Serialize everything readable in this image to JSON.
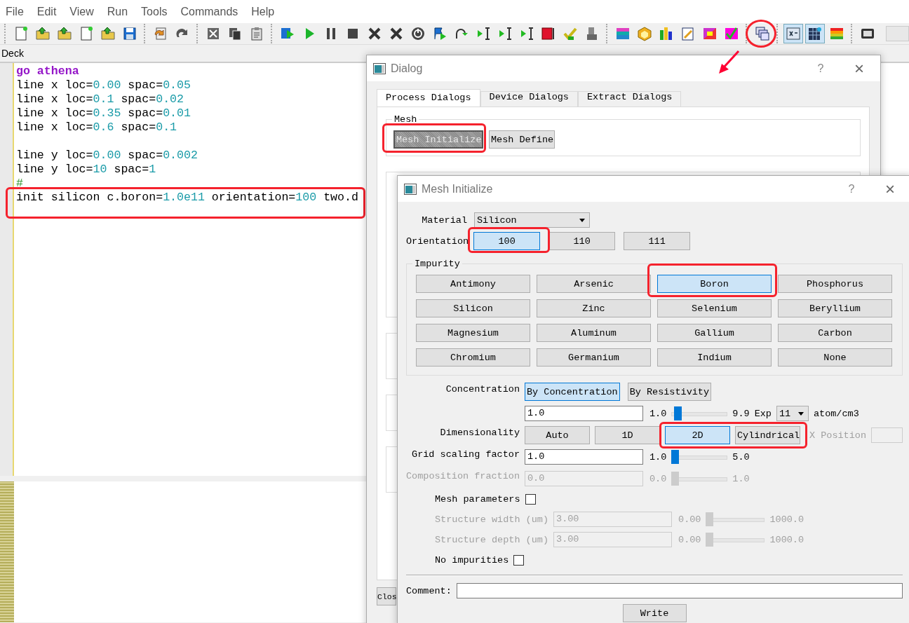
{
  "menu": [
    "File",
    "Edit",
    "View",
    "Run",
    "Tools",
    "Commands",
    "Help"
  ],
  "toolbar": [
    {
      "buttons": [
        {
          "kind": "page"
        },
        {
          "kind": "folder"
        },
        {
          "kind": "folder"
        },
        {
          "kind": "page"
        },
        {
          "kind": "folder"
        },
        {
          "kind": "floppy"
        }
      ]
    },
    {
      "buttons": [
        {
          "kind": "undo"
        },
        {
          "kind": "redo"
        }
      ]
    },
    {
      "buttons": [
        {
          "kind": "scissors"
        },
        {
          "kind": "copy"
        },
        {
          "kind": "clipboard"
        }
      ]
    },
    {
      "buttons": [
        {
          "kind": "floppy-play"
        },
        {
          "kind": "play"
        },
        {
          "kind": "pause"
        },
        {
          "kind": "stop"
        },
        {
          "kind": "cross"
        },
        {
          "kind": "cross"
        },
        {
          "kind": "power"
        },
        {
          "kind": "flag"
        },
        {
          "kind": "curve"
        },
        {
          "kind": "step"
        },
        {
          "kind": "step"
        },
        {
          "kind": "step"
        },
        {
          "kind": "red-square"
        },
        {
          "kind": "check"
        },
        {
          "kind": "device"
        }
      ]
    },
    {
      "buttons": [
        {
          "kind": "layers"
        },
        {
          "kind": "cube"
        },
        {
          "kind": "chart"
        },
        {
          "kind": "pencil"
        },
        {
          "kind": "palette"
        },
        {
          "kind": "check-grid"
        }
      ]
    },
    {
      "buttons": [
        {
          "kind": "windows",
          "highlighted": true,
          "arrow": true
        }
      ]
    },
    {
      "buttons": [
        {
          "kind": "formula",
          "on": true
        },
        {
          "kind": "table",
          "on": true
        },
        {
          "kind": "bars",
          "on": false
        }
      ]
    },
    {
      "buttons": [
        {
          "kind": "monitor"
        }
      ]
    }
  ],
  "deck": {
    "label": "Deck",
    "lines": [
      {
        "kind": "code",
        "tokens": [
          {
            "kind": "keyword",
            "text": "go athena"
          }
        ]
      },
      {
        "kind": "code",
        "tokens": [
          {
            "kind": "text",
            "text": "line x loc="
          },
          {
            "kind": "number",
            "text": "0.00"
          },
          {
            "kind": "text",
            "text": " spac="
          },
          {
            "kind": "number",
            "text": "0.05"
          }
        ]
      },
      {
        "kind": "code",
        "tokens": [
          {
            "kind": "text",
            "text": "line x loc="
          },
          {
            "kind": "number",
            "text": "0.1"
          },
          {
            "kind": "text",
            "text": " spac="
          },
          {
            "kind": "number",
            "text": "0.02"
          }
        ]
      },
      {
        "kind": "code",
        "tokens": [
          {
            "kind": "text",
            "text": "line x loc="
          },
          {
            "kind": "number",
            "text": "0.35"
          },
          {
            "kind": "text",
            "text": " spac="
          },
          {
            "kind": "number",
            "text": "0.01"
          }
        ]
      },
      {
        "kind": "code",
        "tokens": [
          {
            "kind": "text",
            "text": "line x loc="
          },
          {
            "kind": "number",
            "text": "0.6"
          },
          {
            "kind": "text",
            "text": " spac="
          },
          {
            "kind": "number",
            "text": "0.1"
          }
        ]
      },
      {
        "kind": "blank"
      },
      {
        "kind": "code",
        "tokens": [
          {
            "kind": "text",
            "text": "line y loc="
          },
          {
            "kind": "number",
            "text": "0.00"
          },
          {
            "kind": "text",
            "text": " spac="
          },
          {
            "kind": "number",
            "text": "0.002"
          }
        ]
      },
      {
        "kind": "code",
        "tokens": [
          {
            "kind": "text",
            "text": "line y loc="
          },
          {
            "kind": "number",
            "text": "10"
          },
          {
            "kind": "text",
            "text": " spac="
          },
          {
            "kind": "number",
            "text": "1"
          }
        ]
      },
      {
        "kind": "code",
        "tokens": [
          {
            "kind": "comment",
            "text": "#"
          }
        ]
      },
      {
        "kind": "code",
        "highlighted": true,
        "tokens": [
          {
            "kind": "text",
            "text": "init silicon c.boron="
          },
          {
            "kind": "number",
            "text": "1.0e11"
          },
          {
            "kind": "text",
            "text": " orientation="
          },
          {
            "kind": "number",
            "text": "100"
          },
          {
            "kind": "text",
            "text": " two.d"
          }
        ]
      }
    ]
  },
  "dialog": {
    "title": "Dialog",
    "help": "?",
    "close": "×",
    "tabs": [
      {
        "label": "Process Dialogs",
        "selected": true
      },
      {
        "label": "Device Dialogs",
        "selected": false
      },
      {
        "label": "Extract Dialogs",
        "selected": false
      }
    ],
    "mesh_group": {
      "title": "Mesh",
      "buttons": [
        {
          "label": "Mesh Initialize",
          "pressed": true,
          "highlighted": true
        },
        {
          "label": "Mesh Define",
          "pressed": false,
          "highlighted": false
        }
      ]
    },
    "close_button": "Clos"
  },
  "mesh_initialize": {
    "title": "Mesh Initialize",
    "help": "?",
    "close": "×",
    "material": {
      "label": "Material",
      "value": "Silicon"
    },
    "orientation": {
      "label": "Orientation",
      "options": [
        {
          "label": "100",
          "selected": true,
          "highlighted": true
        },
        {
          "label": "110",
          "selected": false
        },
        {
          "label": "111",
          "selected": false
        }
      ]
    },
    "impurity": {
      "title": "Impurity",
      "options": [
        {
          "label": "Antimony",
          "selected": false
        },
        {
          "label": "Arsenic",
          "selected": false
        },
        {
          "label": "Boron",
          "selected": true,
          "highlighted": true
        },
        {
          "label": "Phosphorus",
          "selected": false
        },
        {
          "label": "Silicon",
          "selected": false
        },
        {
          "label": "Zinc",
          "selected": false
        },
        {
          "label": "Selenium",
          "selected": false
        },
        {
          "label": "Beryllium",
          "selected": false
        },
        {
          "label": "Magnesium",
          "selected": false
        },
        {
          "label": "Aluminum",
          "selected": false
        },
        {
          "label": "Gallium",
          "selected": false
        },
        {
          "label": "Carbon",
          "selected": false
        },
        {
          "label": "Chromium",
          "selected": false
        },
        {
          "label": "Germanium",
          "selected": false
        },
        {
          "label": "Indium",
          "selected": false
        },
        {
          "label": "None",
          "selected": false
        }
      ]
    },
    "concentration": {
      "label": "Concentration",
      "modes": [
        {
          "label": "By Concentration",
          "selected": true
        },
        {
          "label": "By Resistivity",
          "selected": false
        }
      ],
      "value": "1.0",
      "min": "1.0",
      "level": 0.05,
      "max": "9.9",
      "exp_label": "Exp",
      "exp_value": "11",
      "unit": "atom/cm3"
    },
    "dimensionality": {
      "label": "Dimensionality",
      "options": [
        {
          "label": "Auto",
          "selected": false
        },
        {
          "label": "1D",
          "selected": false
        },
        {
          "label": "2D",
          "selected": true,
          "highlighted": true
        },
        {
          "label": "Cylindrical",
          "selected": false,
          "highlighted": true
        }
      ],
      "x_position_label": "X Position"
    },
    "rows": [
      {
        "kind": "slider",
        "label": "Grid scaling factor",
        "value": "1.0",
        "min": "1.0",
        "max": "5.0",
        "level": 0,
        "disabled": false
      },
      {
        "kind": "slider",
        "label": "Composition fraction",
        "value": "0.0",
        "min": "0.0",
        "max": "1.0",
        "level": 0,
        "disabled": true
      },
      {
        "kind": "checkbox",
        "label": "Mesh parameters",
        "checked": false
      },
      {
        "kind": "subslider",
        "label": "Structure width (um)",
        "value": "3.00",
        "min": "0.00",
        "max": "1000.0",
        "level": 0,
        "disabled": true
      },
      {
        "kind": "subslider",
        "label": "Structure depth (um)",
        "value": "3.00",
        "min": "0.00",
        "max": "1000.0",
        "level": 0,
        "disabled": true
      },
      {
        "kind": "checkbox",
        "label": "No impurities",
        "checked": false
      }
    ],
    "comment_label": "Comment:",
    "write_button": "Write"
  }
}
